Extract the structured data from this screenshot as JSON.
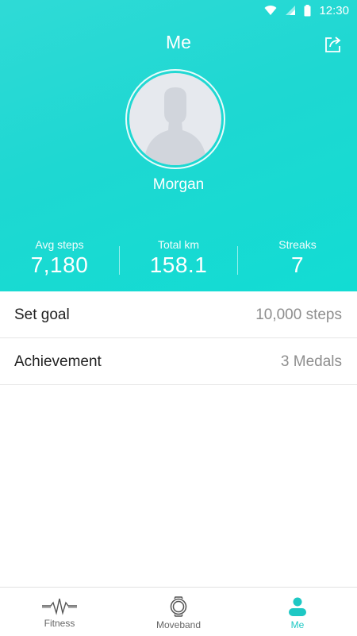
{
  "status_bar": {
    "time": "12:30"
  },
  "header": {
    "title": "Me",
    "username": "Morgan"
  },
  "stats": [
    {
      "label": "Avg steps",
      "value": "7,180"
    },
    {
      "label": "Total km",
      "value": "158.1"
    },
    {
      "label": "Streaks",
      "value": "7"
    }
  ],
  "settings": [
    {
      "label": "Set goal",
      "value": "10,000 steps"
    },
    {
      "label": "Achievement",
      "value": "3 Medals"
    }
  ],
  "tabs": [
    {
      "label": "Fitness",
      "icon": "heartbeat-icon",
      "active": false
    },
    {
      "label": "Moveband",
      "icon": "band-icon",
      "active": false
    },
    {
      "label": "Me",
      "icon": "person-icon",
      "active": true
    }
  ],
  "colors": {
    "accent": "#1ed8d2",
    "active_tab": "#1ec8c4"
  }
}
